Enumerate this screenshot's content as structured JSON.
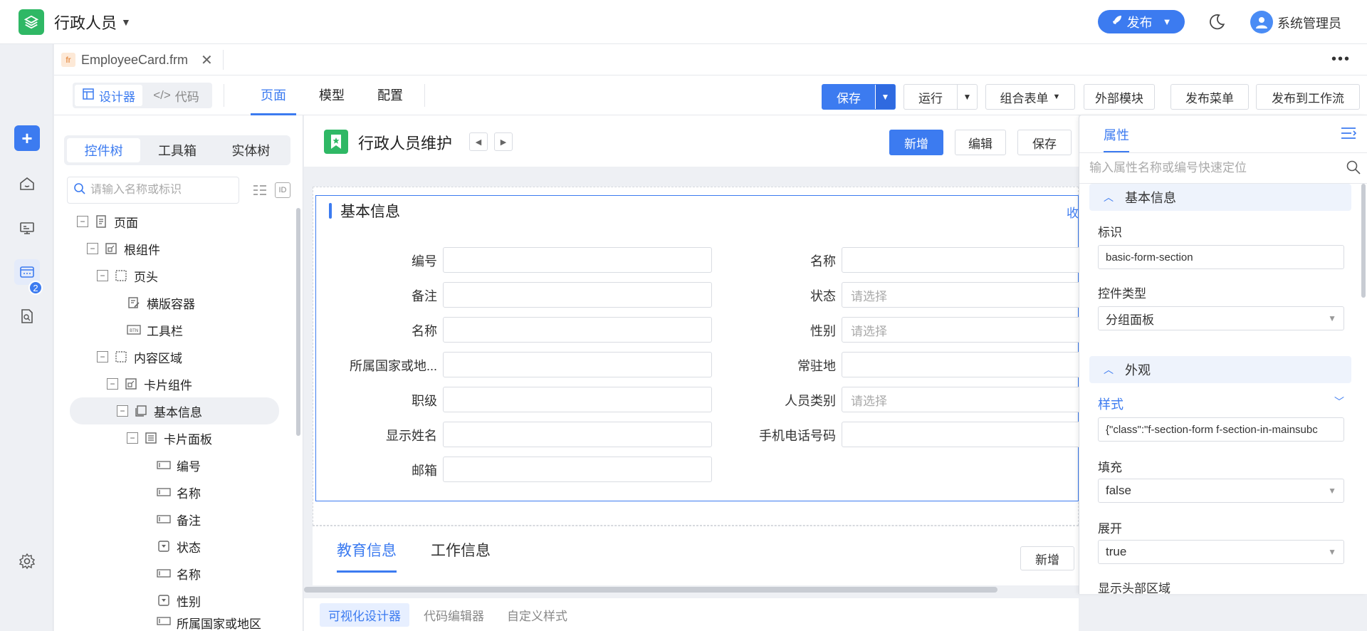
{
  "header": {
    "app_title": "行政人员",
    "publish_label": "发布",
    "user_name": "系统管理员"
  },
  "rail": {
    "badge_count": "2"
  },
  "file_tab": {
    "badge": "fr",
    "name": "EmployeeCard.frm",
    "close": "✕",
    "more": "•••"
  },
  "toolbar": {
    "designer": "设计器",
    "code": "代码",
    "view_tabs": [
      "页面",
      "模型",
      "配置"
    ],
    "save": "保存",
    "run": "运行",
    "combo_form": "组合表单",
    "external_module": "外部模块",
    "publish_menu": "发布菜单",
    "publish_workflow": "发布到工作流"
  },
  "left_panel": {
    "tabs": [
      "控件树",
      "工具箱",
      "实体树"
    ],
    "search_placeholder": "请输入名称或标识",
    "id_label": "ID",
    "tree": [
      {
        "label": "页面"
      },
      {
        "label": "根组件"
      },
      {
        "label": "页头"
      },
      {
        "label": "横版容器"
      },
      {
        "label": "工具栏"
      },
      {
        "label": "内容区域"
      },
      {
        "label": "卡片组件"
      },
      {
        "label": "基本信息"
      },
      {
        "label": "卡片面板"
      },
      {
        "label": "编号"
      },
      {
        "label": "名称"
      },
      {
        "label": "备注"
      },
      {
        "label": "状态"
      },
      {
        "label": "名称"
      },
      {
        "label": "性别"
      },
      {
        "label": "所属国家或地区"
      }
    ]
  },
  "canvas": {
    "page_title": "行政人员维护",
    "buttons": {
      "new": "新增",
      "edit": "编辑",
      "save": "保存"
    },
    "section": {
      "title": "基本信息",
      "collapse": "收",
      "fields_left": [
        {
          "label": "编号",
          "value": ""
        },
        {
          "label": "备注",
          "value": ""
        },
        {
          "label": "名称",
          "value": ""
        },
        {
          "label": "所属国家或地...",
          "value": ""
        },
        {
          "label": "职级",
          "value": ""
        },
        {
          "label": "显示姓名",
          "value": ""
        },
        {
          "label": "邮箱",
          "value": ""
        }
      ],
      "fields_right": [
        {
          "label": "名称",
          "value": ""
        },
        {
          "label": "状态",
          "value": "请选择"
        },
        {
          "label": "性别",
          "value": "请选择"
        },
        {
          "label": "常驻地",
          "value": ""
        },
        {
          "label": "人员类别",
          "value": "请选择"
        },
        {
          "label": "手机电话号码",
          "value": ""
        }
      ]
    },
    "detail_tabs": [
      "教育信息",
      "工作信息"
    ],
    "detail_new": "新增"
  },
  "bottom_tabs": [
    "可视化设计器",
    "代码编辑器",
    "自定义样式"
  ],
  "props": {
    "tab": "属性",
    "search_placeholder": "输入属性名称或编号快速定位",
    "group_basic": "基本信息",
    "id_label": "标识",
    "id_value": "basic-form-section",
    "type_label": "控件类型",
    "type_value": "分组面板",
    "group_appearance": "外观",
    "style_label": "样式",
    "style_value": "{\"class\":\"f-section-form f-section-in-mainsubc",
    "fill_label": "填充",
    "fill_value": "false",
    "expand_label": "展开",
    "expand_value": "true",
    "show_header_label": "显示头部区域"
  },
  "colors": {
    "accent": "#3c7bf0",
    "brand_green": "#2fb865"
  }
}
